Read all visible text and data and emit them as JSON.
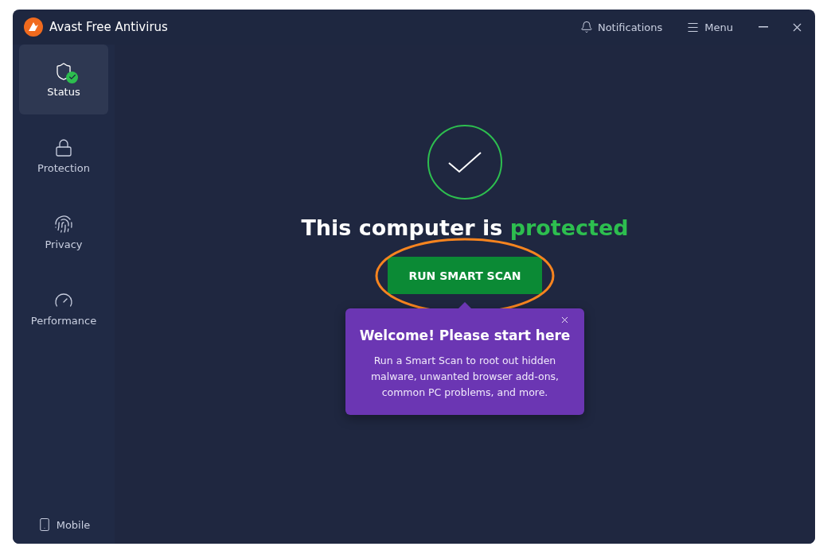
{
  "window": {
    "title": "Avast Free Antivirus"
  },
  "header_actions": [
    {
      "label": "Notifications"
    },
    {
      "label": "Menu"
    }
  ],
  "sidebar": {
    "items": [
      {
        "label": "Status",
        "selected": true
      },
      {
        "label": "Protection",
        "selected": false
      },
      {
        "label": "Privacy",
        "selected": false
      },
      {
        "label": "Performance",
        "selected": false
      }
    ],
    "footer": {
      "label": "Mobile"
    }
  },
  "status": {
    "prefix": "This computer is",
    "state": "protected",
    "protected": true
  },
  "scan_button": {
    "label": "RUN SMART SCAN",
    "highlighted": true
  },
  "tooltip": {
    "title": "Welcome! Please start here",
    "body": "Run a Smart Scan to root out hidden malware, unwanted browser add-ons, common PC problems, and more."
  }
}
